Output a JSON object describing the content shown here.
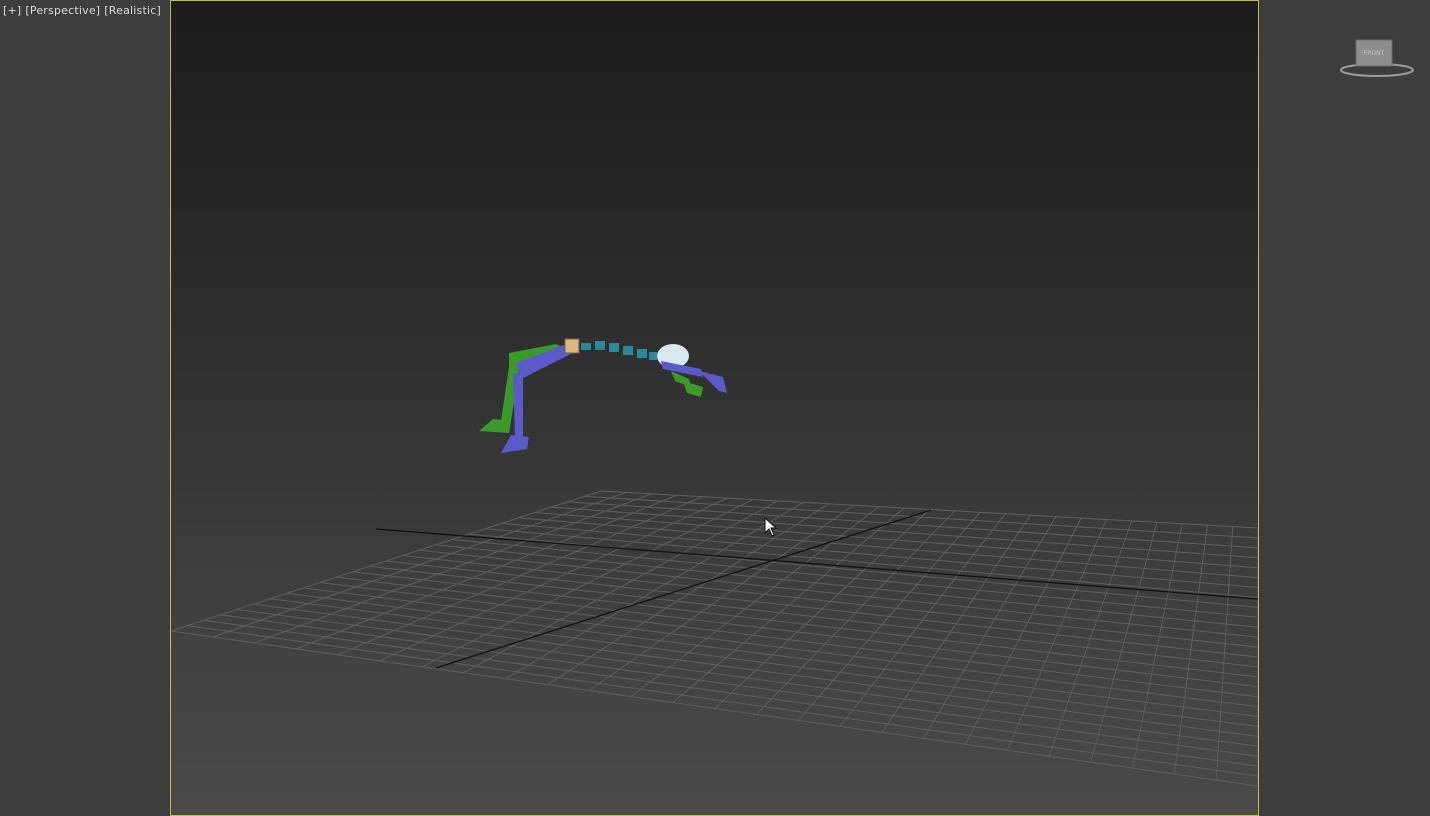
{
  "viewport_label": {
    "plus": "[+]",
    "view": "[Perspective]",
    "shading": "[Realistic]"
  },
  "viewcube": {
    "face_label": "FRONT"
  },
  "colors": {
    "frame_active": "#c9bd3a",
    "background": "#3d3d3d",
    "biped_left": "#3a9a2a",
    "biped_right": "#5a5ac8",
    "spine": "#2a8a9a",
    "grid_line": "#5e5e5e",
    "world_axis": "#111111"
  },
  "icons": {
    "viewcube": "viewcube-icon",
    "cursor": "mouse-pointer-icon"
  }
}
